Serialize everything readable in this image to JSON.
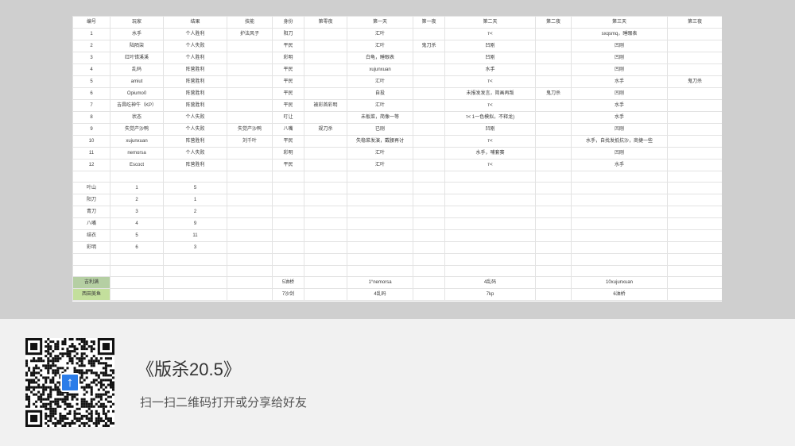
{
  "sheet": {
    "columns": [
      "编号",
      "玩家",
      "结果",
      "技能",
      "身份",
      "第零夜",
      "第一天",
      "第一夜",
      "第二天",
      "第二夜",
      "第三天",
      "第三夜"
    ],
    "rows": [
      {
        "cells": [
          "1",
          "水手",
          "个人胜利",
          "护法风子",
          "阳刀",
          "",
          "汇叶",
          "",
          "ᴛ<",
          "",
          "sxqsmq，睡眼表",
          ""
        ],
        "red": true
      },
      {
        "cells": [
          "2",
          "陆陌柒",
          "个人失败",
          "",
          "平民",
          "",
          "汇叶",
          "鬼刀杀",
          "凹刚",
          "",
          "凹刚",
          ""
        ],
        "red": true
      },
      {
        "cells": [
          "3",
          "红叶错溪溪",
          "个人胜利",
          "",
          "彩明",
          "",
          "白龟，睡眼表",
          "",
          "凹刚",
          "",
          "凹刚",
          ""
        ],
        "red": true
      },
      {
        "cells": [
          "4",
          "乱码",
          "阵营胜利",
          "",
          "平民",
          "",
          "xujunxuan",
          "",
          "水手",
          "",
          "凹刚",
          ""
        ],
        "red": false
      },
      {
        "cells": [
          "5",
          "amiut",
          "阵营胜利",
          "",
          "平民",
          "",
          "汇叶",
          "",
          "ᴛ<",
          "",
          "水手",
          "鬼刀杀"
        ],
        "red": true
      },
      {
        "cells": [
          "6",
          "Opiumo0",
          "阵营胜利",
          "",
          "平民",
          "",
          "自投",
          "",
          "未报发发言，简画再叛",
          "鬼刀杀",
          "凹刚",
          ""
        ],
        "red": true
      },
      {
        "cells": [
          "7",
          "吉昌吃神牛（KP）",
          "阵营胜利",
          "",
          "平民",
          "被彩首彩明",
          "汇叶",
          "",
          "ᴛ<",
          "",
          "水手",
          ""
        ],
        "red": false
      },
      {
        "cells": [
          "8",
          "状态",
          "个人失败",
          "",
          "叮让",
          "",
          "未板菜，简像一等",
          "",
          "ᴛ< 1一色模拟，不释龙)",
          "",
          "水手",
          ""
        ],
        "red": false
      },
      {
        "cells": [
          "9",
          "失觉产沙鸭",
          "个人失败",
          "失觉产沙鸭",
          "八嘴",
          "规刀杀",
          "已刚",
          "",
          "凹刚",
          "",
          "凹刚",
          ""
        ],
        "red": true
      },
      {
        "cells": [
          "10",
          "xujunxuan",
          "阵营胜利",
          "刘千叶",
          "平民",
          "",
          "失稳菜发演，戴腰再讨",
          "",
          "ᴛ<",
          "",
          "水手，自找发抵抗沙，商捷一些",
          ""
        ],
        "red": false
      },
      {
        "cells": [
          "11",
          "nemorsa",
          "个人失败",
          "",
          "彩明",
          "",
          "汇叶",
          "",
          "水手，哺套赛",
          "",
          "凹刚",
          ""
        ],
        "red": true
      },
      {
        "cells": [
          "12",
          "Escoct",
          "阵营胜利",
          "",
          "平民",
          "",
          "汇叶",
          "",
          "ᴛ<",
          "",
          "水手",
          ""
        ],
        "red": false
      }
    ],
    "summary": [
      {
        "label": "叶山",
        "num": "1",
        "val": "5"
      },
      {
        "label": "阳刀",
        "num": "2",
        "val": "1"
      },
      {
        "label": "青刀",
        "num": "3",
        "val": "2"
      },
      {
        "label": "八嘴",
        "num": "4",
        "val": "9"
      },
      {
        "label": "结衣",
        "num": "5",
        "val": "11"
      },
      {
        "label": "彩明",
        "num": "6",
        "val": "3"
      }
    ],
    "footer_rows": [
      {
        "btn": "吉利满",
        "cells": [
          "",
          "",
          "",
          "5油桥",
          "",
          "1°nemorsa",
          "",
          "4乱码",
          "",
          "10xujunxuan"
        ]
      },
      {
        "btn": "西田美鱼",
        "cells": [
          "",
          "",
          "",
          "7沙剑",
          "",
          "4乱码",
          "",
          "7kp",
          "",
          "6油桥"
        ]
      }
    ]
  },
  "share": {
    "title": "《版杀20.5》",
    "subtitle": "扫一扫二维码打开或分享给好友",
    "logo_glyph": "↑"
  }
}
